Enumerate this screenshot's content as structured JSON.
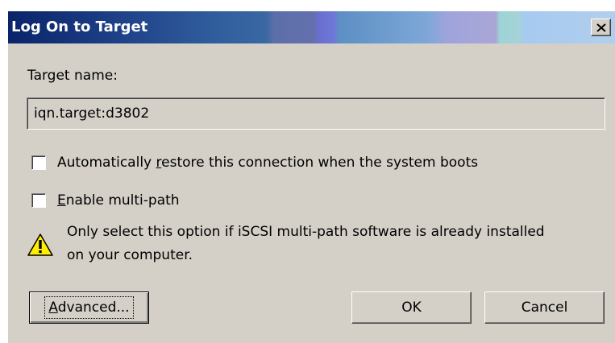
{
  "window": {
    "title": "Log On to Target",
    "close_label": "×"
  },
  "target": {
    "label": "Target name:",
    "value": "iqn.target:d3802"
  },
  "options": {
    "auto_restore": {
      "label_prefix": "Automatically ",
      "label_accel": "r",
      "label_suffix": "estore this connection when the system boots",
      "checked": false
    },
    "multipath": {
      "label_prefix": "",
      "label_accel": "E",
      "label_suffix": "nable multi-path",
      "checked": false
    }
  },
  "warning": {
    "icon": "warning-icon",
    "line1": "Only select this option if iSCSI multi-path software is already installed",
    "line2": "on your computer."
  },
  "buttons": {
    "advanced": {
      "accel": "A",
      "rest": "dvanced..."
    },
    "ok": "OK",
    "cancel": "Cancel"
  }
}
